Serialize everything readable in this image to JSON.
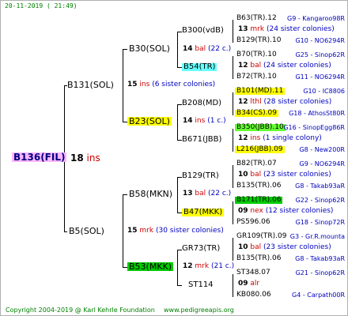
{
  "header": {
    "date": "20-11-2019 ( 21:49)"
  },
  "footer": {
    "copyright": "Copyright 2004-2019 @ Karl Kehrle Foundation",
    "site": "www.pedigreeapis.org"
  },
  "colors": {
    "pink": "#ffb6ff",
    "yellow": "#ffff00",
    "green": "#00cc00",
    "cyan": "#66ffff",
    "lime": "#66ff33"
  },
  "pedigree": {
    "root": {
      "label": "B136(FIL)",
      "n": "18",
      "u": "ins"
    },
    "g1": [
      {
        "label": "B131(SOL)",
        "n": "15",
        "u": "ins",
        "note": "(6 sister colonies)"
      },
      {
        "label": "B5(SOL)",
        "n": "15",
        "u": "mrk",
        "note": "(30 sister colonies)"
      }
    ],
    "g2": [
      {
        "label": "B30(SOL)"
      },
      {
        "label": "B23(SOL)",
        "n": "14",
        "u": "ins",
        "note": "(1 c.)"
      },
      {
        "label": "B58(MKN)",
        "n": "13",
        "u": "bal",
        "note": "(22 c.)"
      },
      {
        "label": "B53(MKK)",
        "n": "12",
        "u": "mrk",
        "note": "(21 c.)"
      }
    ],
    "g3": [
      {
        "label": "B300(vdB)",
        "n": "14",
        "u": "bal",
        "note": "(22 c.)"
      },
      {
        "label": "B54(TR)"
      },
      {
        "label": "B208(MD)"
      },
      {
        "label": "B671(JBB)"
      },
      {
        "label": "B129(TR)"
      },
      {
        "label": "B47(MKK)"
      },
      {
        "label": "GR73(TR)"
      },
      {
        "label": "ST114"
      }
    ],
    "g4": [
      {
        "label": "B63(TR).12",
        "info": "G9 - Kangaroo98R",
        "n": "13",
        "u": "mrk",
        "note": "(24 sister colonies)"
      },
      {
        "label": "B129(TR).10",
        "info": "G10 - NO6294R"
      },
      {
        "label": "B70(TR).10",
        "info": "G25 - Sinop62R",
        "n": "12",
        "u": "bal",
        "note": "(24 sister colonies)"
      },
      {
        "label": "B72(TR).10",
        "info": "G11 - NO6294R"
      },
      {
        "label": "B101(MD).11",
        "info": "G10 - IC8806",
        "n": "12",
        "u": "lthl",
        "note": "(28 sister colonies)"
      },
      {
        "label": "B34(CS).09",
        "info": "G18 - AthosSt80R"
      },
      {
        "label": "B350(JBB).10",
        "info": "G16 - SinopEgg86R",
        "n": "12",
        "u": "ins",
        "note": "(1 single colony)"
      },
      {
        "label": "L216(JBB).09",
        "info": "G8 - New200R"
      },
      {
        "label": "B82(TR).07",
        "info": "G9 - NO6294R",
        "n": "10",
        "u": "bal",
        "note": "(23 sister colonies)"
      },
      {
        "label": "B135(TR).06",
        "info": "G8 - Takab93aR"
      },
      {
        "label": "B171(TR).06",
        "info": "G22 - Sinop62R",
        "n": "09",
        "u": "nex",
        "note": "(12 sister colonies)"
      },
      {
        "label": "PS596.06",
        "info": "G18 - Sinop72R"
      },
      {
        "label": "GR109(TR).09",
        "info": "G3 - Gr.R.mounta",
        "n": "10",
        "u": "bal",
        "note": "(23 sister colonies)"
      },
      {
        "label": "B135(TR).06",
        "info": "G8 - Takab93aR"
      },
      {
        "label": "ST348.07",
        "info": "G21 - Sinop62R",
        "n": "09",
        "u": "alr"
      },
      {
        "label": "KB080.06",
        "info": "G4 - Carpath00R"
      }
    ]
  }
}
